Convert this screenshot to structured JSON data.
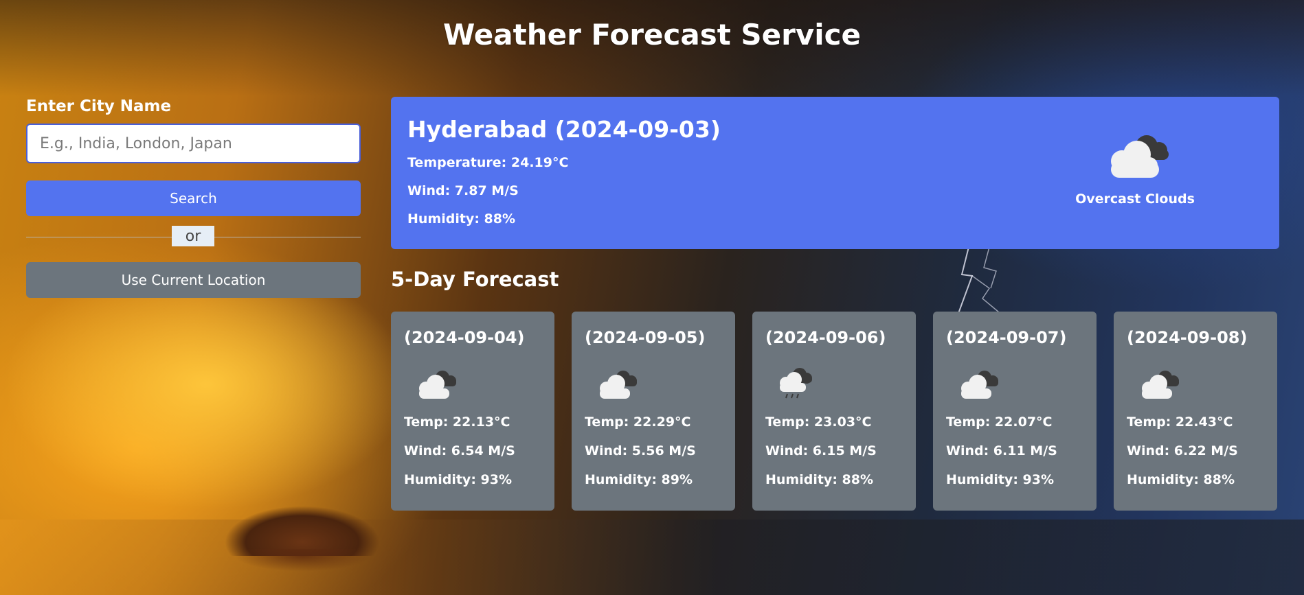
{
  "header": {
    "title": "Weather Forecast Service"
  },
  "search": {
    "label": "Enter City Name",
    "placeholder": "E.g., India, London, Japan",
    "value": "",
    "search_label": "Search",
    "or_label": "or",
    "location_label": "Use Current Location"
  },
  "current": {
    "heading": "Hyderabad (2024-09-03)",
    "temperature": "Temperature: 24.19°C",
    "wind": "Wind: 7.87 M/S",
    "humidity": "Humidity: 88%",
    "icon": "overcast-clouds-icon",
    "description": "Overcast Clouds"
  },
  "forecast": {
    "title": "5-Day Forecast",
    "days": [
      {
        "date": "(2024-09-04)",
        "icon": "broken-clouds-icon",
        "temp": "Temp: 22.13°C",
        "wind": "Wind: 6.54 M/S",
        "humidity": "Humidity: 93%"
      },
      {
        "date": "(2024-09-05)",
        "icon": "broken-clouds-icon",
        "temp": "Temp: 22.29°C",
        "wind": "Wind: 5.56 M/S",
        "humidity": "Humidity: 89%"
      },
      {
        "date": "(2024-09-06)",
        "icon": "rain-cloud-icon",
        "temp": "Temp: 23.03°C",
        "wind": "Wind: 6.15 M/S",
        "humidity": "Humidity: 88%"
      },
      {
        "date": "(2024-09-07)",
        "icon": "broken-clouds-icon",
        "temp": "Temp: 22.07°C",
        "wind": "Wind: 6.11 M/S",
        "humidity": "Humidity: 93%"
      },
      {
        "date": "(2024-09-08)",
        "icon": "broken-clouds-icon",
        "temp": "Temp: 22.43°C",
        "wind": "Wind: 6.22 M/S",
        "humidity": "Humidity: 88%"
      }
    ]
  },
  "colors": {
    "primary": "#5373ef",
    "secondary": "#6c757d",
    "text": "#ffffff"
  }
}
